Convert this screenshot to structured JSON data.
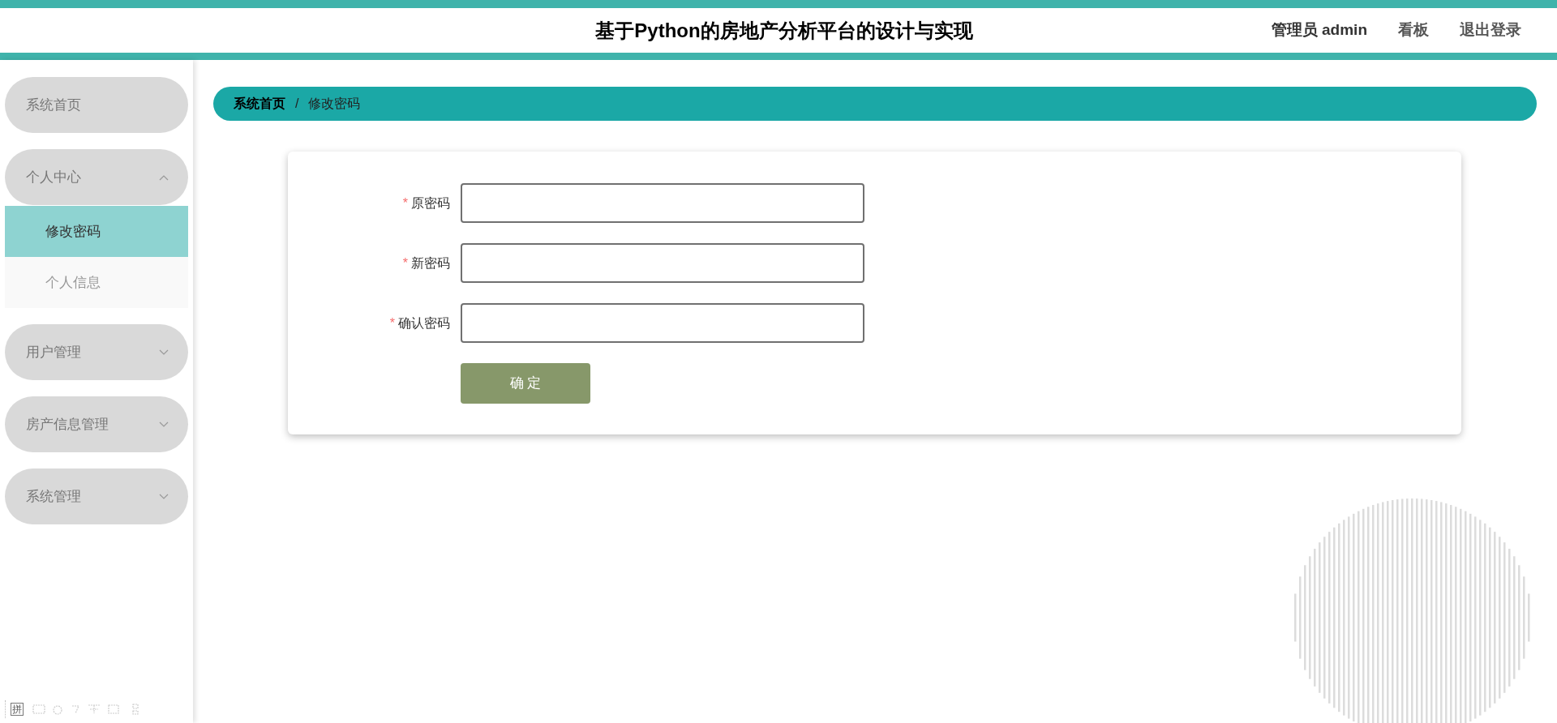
{
  "header": {
    "title": "基于Python的房地产分析平台的设计与实现",
    "user": "管理员 admin",
    "links": [
      "看板",
      "退出登录"
    ]
  },
  "sidebar": {
    "items": [
      {
        "label": "系统首页",
        "kind": "link"
      },
      {
        "label": "个人中心",
        "kind": "group",
        "expanded": true,
        "children": [
          {
            "label": "修改密码",
            "selected": true
          },
          {
            "label": "个人信息",
            "selected": false
          }
        ]
      },
      {
        "label": "用户管理",
        "kind": "group",
        "expanded": false
      },
      {
        "label": "房产信息管理",
        "kind": "group",
        "expanded": false
      },
      {
        "label": "系统管理",
        "kind": "group",
        "expanded": false
      }
    ]
  },
  "breadcrumb": [
    "系统首页",
    "修改密码"
  ],
  "breadcrumb_separator": "/",
  "form": {
    "fields": [
      {
        "label": "原密码",
        "required": true
      },
      {
        "label": "新密码",
        "required": true
      },
      {
        "label": "确认密码",
        "required": true
      }
    ],
    "required_mark": "*",
    "submit": "确 定"
  },
  "ime_toolbar": {
    "mode": "拼"
  }
}
